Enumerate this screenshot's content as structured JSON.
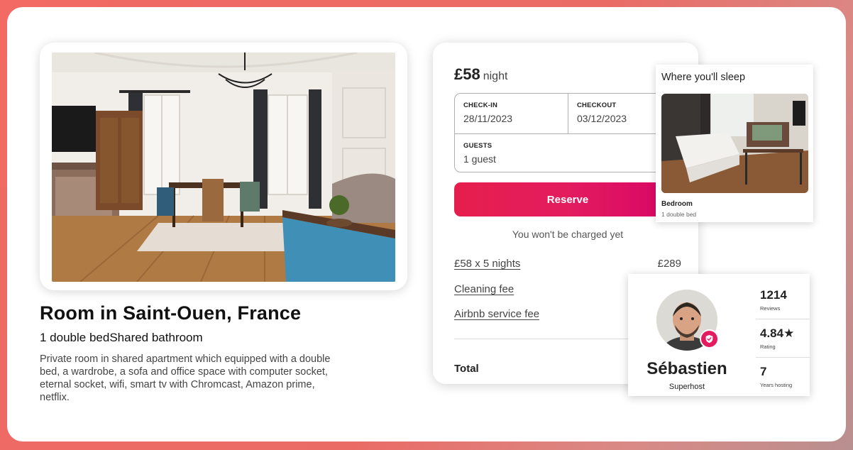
{
  "listing": {
    "title": "Room in Saint-Ouen, France",
    "subtitle": "1 double bedShared bathroom",
    "description": "Private room in shared apartment which equipped with a double bed, a wardrobe, a sofa and office space with computer socket, eternal socket, wifi, smart tv with Chromcast, Amazon prime, netflix."
  },
  "booking": {
    "price": "£58",
    "price_unit": "night",
    "checkin_label": "CHECK-IN",
    "checkin_value": "28/11/2023",
    "checkout_label": "CHECKOUT",
    "checkout_value": "03/12/2023",
    "guests_label": "GUESTS",
    "guests_value": "1 guest",
    "reserve_label": "Reserve",
    "charge_note": "You won't be charged yet",
    "fees": [
      {
        "label": "£58 x 5 nights",
        "value": "£289"
      },
      {
        "label": "Cleaning fee",
        "value": ""
      },
      {
        "label": "Airbnb service fee",
        "value": ""
      }
    ],
    "total_label": "Total"
  },
  "sleep": {
    "title": "Where you'll sleep",
    "room": "Bedroom",
    "bed": "1 double bed"
  },
  "host": {
    "name": "Sébastien",
    "role": "Superhost",
    "stats": [
      {
        "value": "1214",
        "label": "Reviews"
      },
      {
        "value": "4.84★",
        "label": "Rating"
      },
      {
        "value": "7",
        "label": "Years hosting"
      }
    ]
  },
  "colors": {
    "accent": "#e31c5f",
    "background": "#f26a63"
  }
}
